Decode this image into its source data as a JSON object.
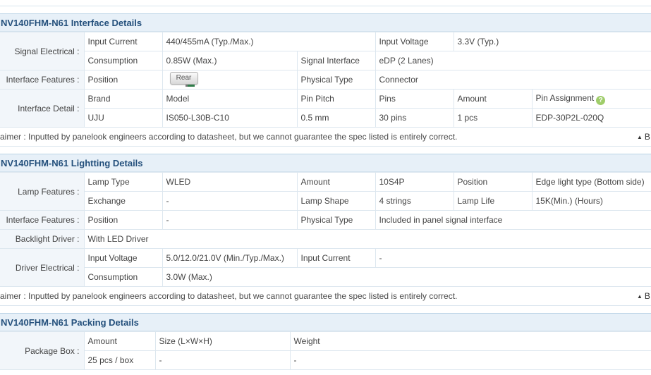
{
  "interface": {
    "title": "NV140FHM-N61 Interface Details",
    "signal_electrical": {
      "label": "Signal Electrical :",
      "input_current_label": "Input Current",
      "input_current_value": "440/455mA (Typ./Max.)",
      "input_voltage_label": "Input Voltage",
      "input_voltage_value": "3.3V (Typ.)",
      "consumption_label": "Consumption",
      "consumption_value": "0.85W (Max.)",
      "signal_interface_label": "Signal Interface",
      "signal_interface_value": "eDP (2 Lanes)"
    },
    "interface_features": {
      "label": "Interface Features :",
      "position_label": "Position",
      "position_value": "Rear",
      "physical_type_label": "Physical Type",
      "physical_type_value": "Connector"
    },
    "interface_detail": {
      "label": "Interface Detail :",
      "headers": [
        "Brand",
        "Model",
        "Pin Pitch",
        "Pins",
        "Amount",
        "Pin Assignment"
      ],
      "row": [
        "UJU",
        "IS050-L30B-C10",
        "0.5 mm",
        "30 pins",
        "1 pcs",
        "EDP-30P2L-020Q"
      ]
    },
    "disclaimer": "aimer : Inputted by panelook engineers according to datasheet, but we cannot guarantee the spec listed is entirely correct.",
    "back_to_top": "B"
  },
  "lighting": {
    "title": "NV140FHM-N61 Lightting Details",
    "lamp_features": {
      "label": "Lamp Features :",
      "lamp_type_label": "Lamp Type",
      "lamp_type_value": "WLED",
      "amount_label": "Amount",
      "amount_value": "10S4P",
      "position_label": "Position",
      "position_value": "Edge light type (Bottom side)",
      "exchange_label": "Exchange",
      "exchange_value": "-",
      "lamp_shape_label": "Lamp Shape",
      "lamp_shape_value": "4 strings",
      "lamp_life_label": "Lamp Life",
      "lamp_life_value": "15K(Min.) (Hours)"
    },
    "interface_features": {
      "label": "Interface Features :",
      "position_label": "Position",
      "position_value": "-",
      "physical_type_label": "Physical Type",
      "physical_type_value": "Included in panel signal interface"
    },
    "backlight_driver": {
      "label": "Backlight Driver :",
      "value": "With LED Driver"
    },
    "driver_electrical": {
      "label": "Driver Electrical :",
      "input_voltage_label": "Input Voltage",
      "input_voltage_value": "5.0/12.0/21.0V (Min./Typ./Max.)",
      "input_current_label": "Input Current",
      "input_current_value": "-",
      "consumption_label": "Consumption",
      "consumption_value": "3.0W (Max.)"
    },
    "disclaimer": "aimer : Inputted by panelook engineers according to datasheet, but we cannot guarantee the spec listed is entirely correct.",
    "back_to_top": "B"
  },
  "packing": {
    "title": "NV140FHM-N61 Packing Details",
    "package_box": {
      "label": "Package Box :",
      "headers": [
        "Amount",
        "Size (L×W×H)",
        "Weight"
      ],
      "row": [
        "25 pcs / box",
        "-",
        "-"
      ]
    }
  },
  "icons": {
    "help": "help-icon",
    "help_glyph": "?",
    "back_to_top": "up-arrow-icon",
    "back_to_top_glyph": "▲",
    "connector_marker": "connector-marker-icon"
  },
  "colors": {
    "header_bg": "#e7f0f8",
    "header_text": "#24507c",
    "label_bg": "#f2f6fa",
    "grid": "#dde7ef",
    "help_icon": "#9fcd6a"
  }
}
